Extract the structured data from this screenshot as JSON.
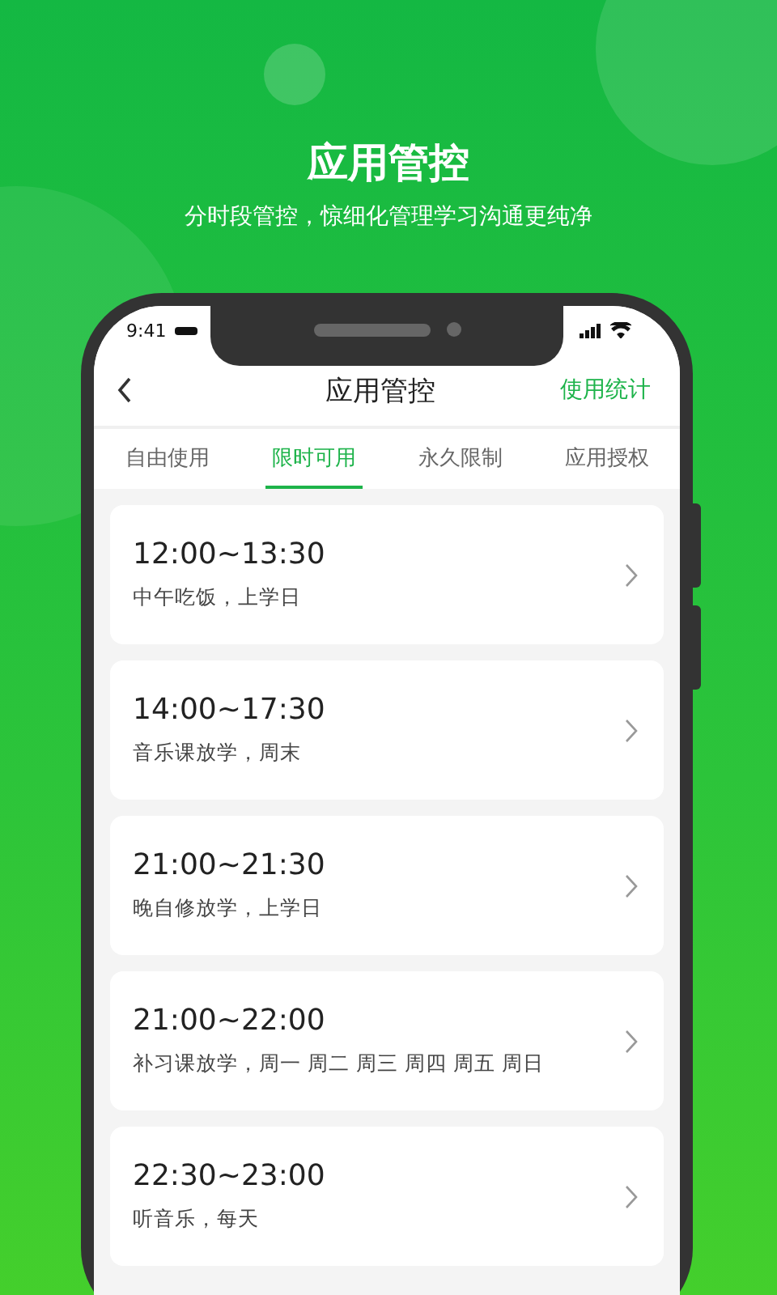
{
  "promo": {
    "title": "应用管控",
    "subtitle": "分时段管控，惊细化管理学习沟通更纯净"
  },
  "status_bar": {
    "time": "9:41"
  },
  "header": {
    "title": "应用管控",
    "action": "使用统计"
  },
  "tabs": [
    {
      "label": "自由使用",
      "selected": false
    },
    {
      "label": "限时可用",
      "selected": true
    },
    {
      "label": "永久限制",
      "selected": false
    },
    {
      "label": "应用授权",
      "selected": false
    }
  ],
  "schedules": [
    {
      "time": "12:00~13:30",
      "note": "中午吃饭，上学日"
    },
    {
      "time": "14:00~17:30",
      "note": "音乐课放学，周末"
    },
    {
      "time": "21:00~21:30",
      "note": "晚自修放学，上学日"
    },
    {
      "time": "21:00~22:00",
      "note": "补习课放学，周一 周二 周三 周四 周五 周日"
    },
    {
      "time": "22:30~23:00",
      "note": "听音乐，每天"
    }
  ]
}
